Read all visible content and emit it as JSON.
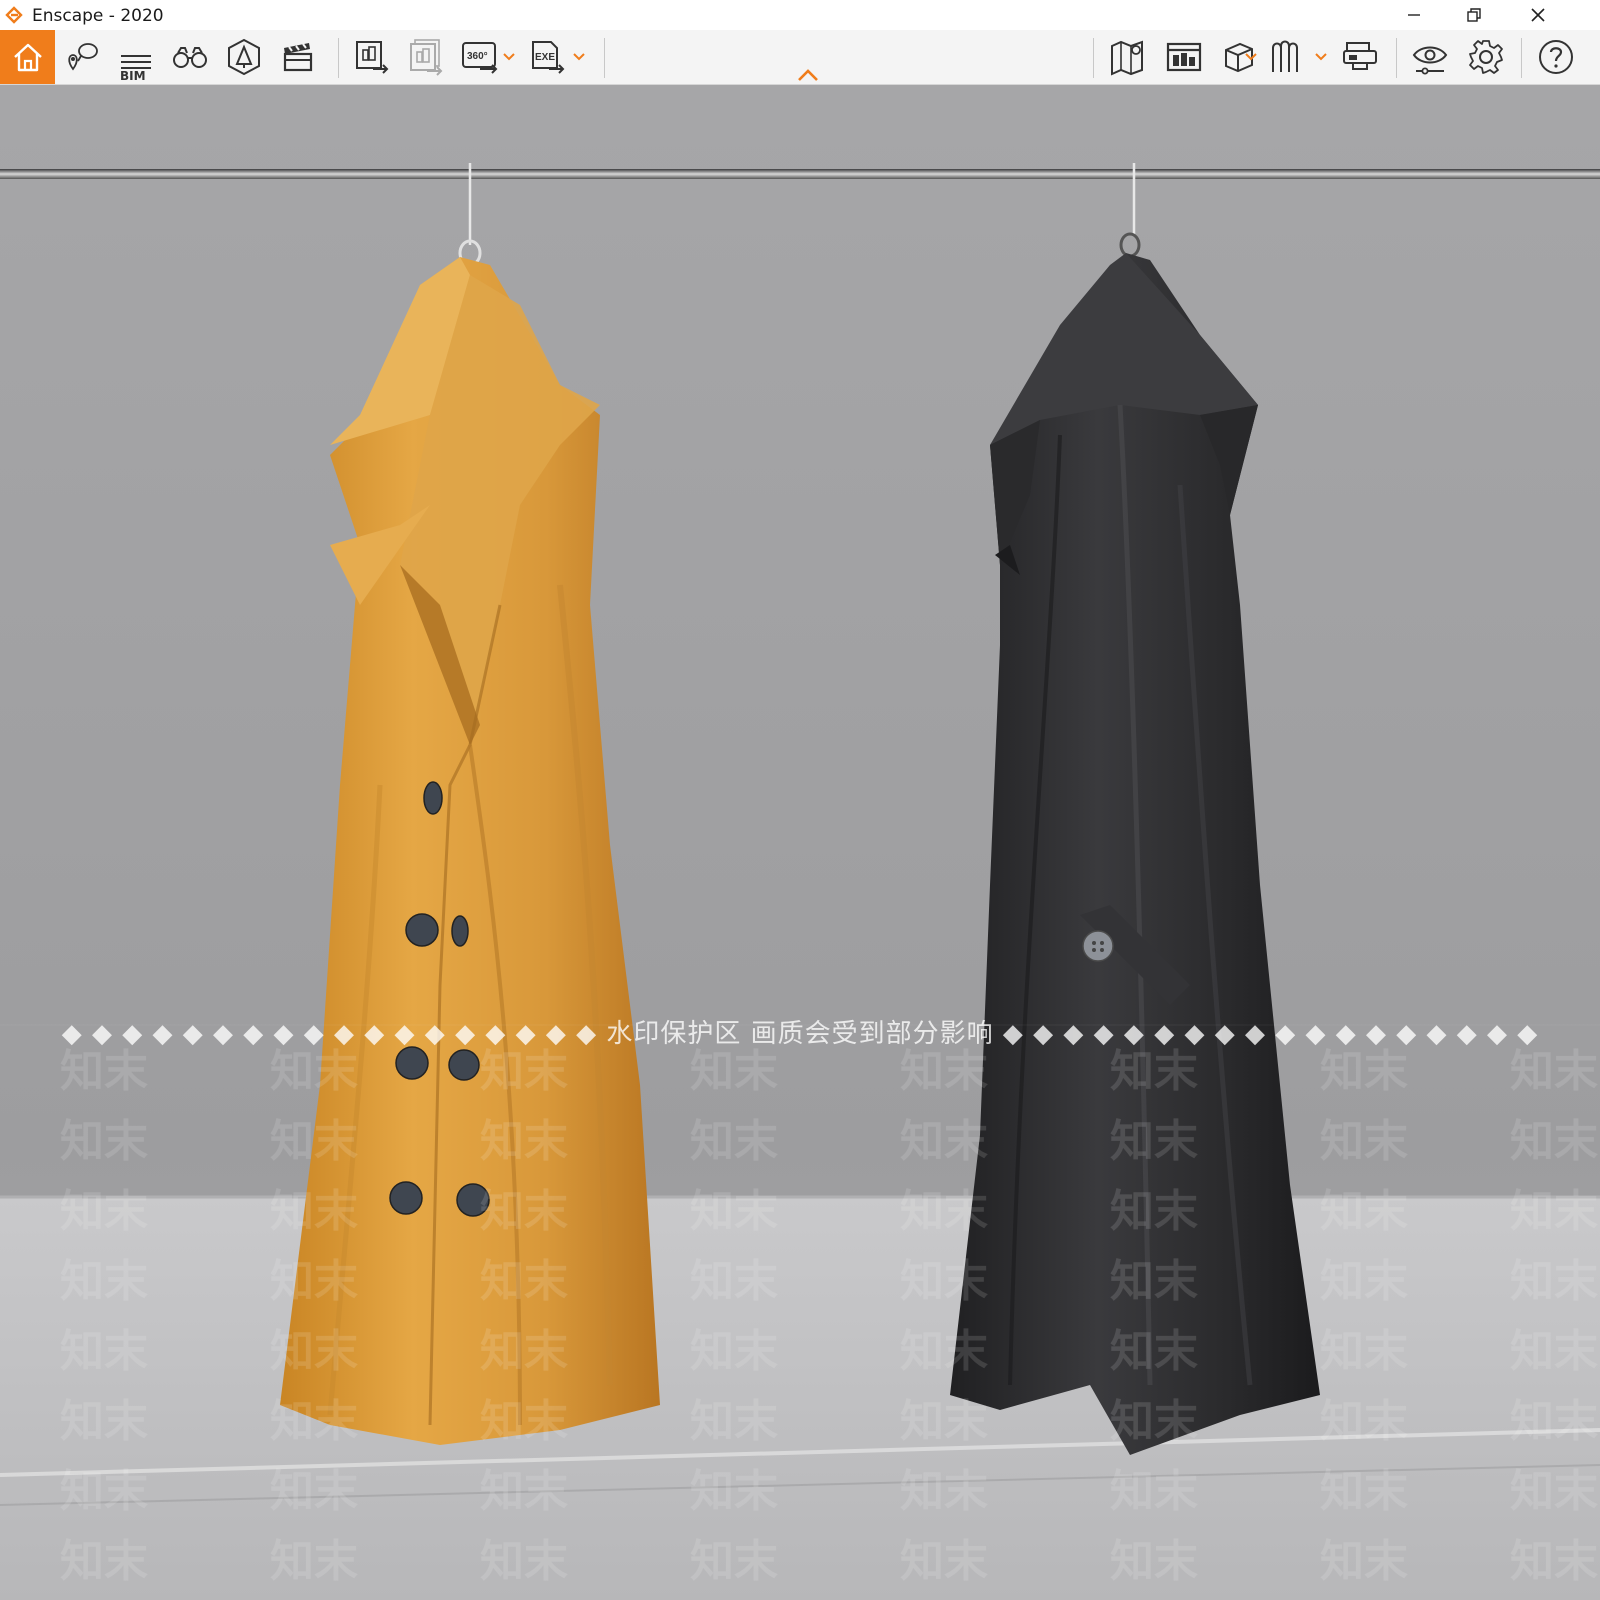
{
  "window": {
    "title": "Enscape - 2020",
    "controls": [
      "minimize",
      "restore",
      "close"
    ]
  },
  "toolbar": {
    "left_items": [
      {
        "id": "home",
        "icon": "home-icon",
        "active": true
      },
      {
        "id": "views",
        "icon": "map-pin-icon"
      },
      {
        "id": "bim",
        "icon": "bim-icon",
        "label": "BIM"
      },
      {
        "id": "binoculars",
        "icon": "binoculars-icon"
      },
      {
        "id": "asset",
        "icon": "asset-library-icon"
      },
      {
        "id": "video",
        "icon": "clapperboard-icon"
      },
      {
        "id": "batch-render",
        "icon": "render-export-icon"
      },
      {
        "id": "batch-render-disabled",
        "icon": "batch-export-icon"
      },
      {
        "id": "panorama",
        "icon": "panorama-360-icon",
        "label": "360°"
      },
      {
        "id": "exe",
        "icon": "exe-export-icon",
        "label": "EXE"
      }
    ],
    "right_items": [
      {
        "id": "minimap",
        "icon": "map-icon"
      },
      {
        "id": "web",
        "icon": "web-standalone-icon"
      },
      {
        "id": "cube",
        "icon": "cube-icon"
      },
      {
        "id": "panorama-gallery",
        "icon": "gallery-icon"
      },
      {
        "id": "vr",
        "icon": "vr-headset-icon"
      },
      {
        "id": "visual-settings",
        "icon": "eye-settings-icon"
      },
      {
        "id": "settings",
        "icon": "gear-icon"
      },
      {
        "id": "help",
        "icon": "help-icon"
      }
    ],
    "accent_color": "#f07d1b"
  },
  "viewport": {
    "scene": "render of two coats hanging on a rail",
    "coats": [
      {
        "color": "#d99c38",
        "buttons": 7
      },
      {
        "color": "#2f2f31",
        "buttons": 1
      }
    ],
    "watermark_banner": "◆ ◆ ◆ ◆ ◆ ◆ ◆ ◆ ◆ ◆ ◆ ◆ ◆ ◆ ◆ ◆ ◆ ◆ 水印保护区   画质会受到部分影响 ◆ ◆ ◆ ◆ ◆ ◆ ◆ ◆ ◆ ◆ ◆ ◆ ◆ ◆ ◆ ◆ ◆ ◆",
    "watermark_tile": "知末"
  }
}
